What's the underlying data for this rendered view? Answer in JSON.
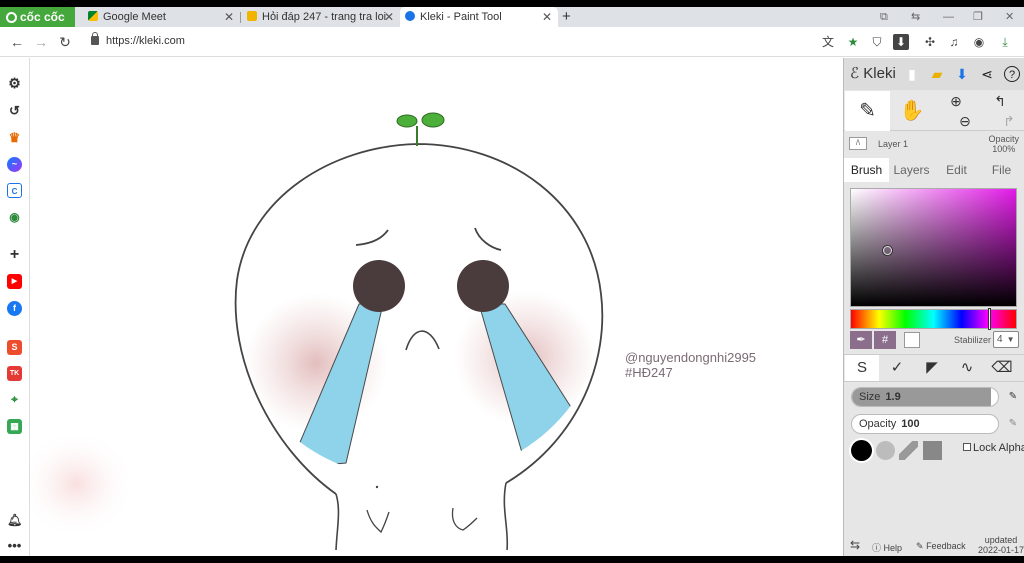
{
  "browser": {
    "brand": "cốc cốc",
    "tabs": [
      {
        "title": "Google Meet",
        "active": false
      },
      {
        "title": "Hỏi đáp 247 - trang tra loi",
        "active": false
      },
      {
        "title": "Kleki - Paint Tool",
        "active": true
      }
    ],
    "new_tab": "+",
    "url": "https://kleki.com"
  },
  "sidebar": {
    "items": [
      "settings-icon",
      "history-icon",
      "crown-icon",
      "messenger-icon",
      "coccoc-icon",
      "game-icon",
      "add-icon",
      "youtube-icon",
      "facebook-icon",
      "shopee-icon",
      "tiki-icon",
      "maps-icon",
      "sheet-icon",
      "bell-icon",
      "more-icon"
    ]
  },
  "canvas": {
    "signature_line1": "@nguyendongnhi2995",
    "signature_line2": "#HĐ247"
  },
  "kleki": {
    "logo": "Kleki",
    "layer": {
      "thumb": "/\\",
      "name": "Layer 1",
      "opacity_label": "Opacity",
      "opacity_value": "100%"
    },
    "tabs": [
      "Brush",
      "Layers",
      "Edit",
      "File"
    ],
    "active_tab": "Brush",
    "color": {
      "hex": "#ffffff",
      "hue_mark": "#f0f"
    },
    "picker_hash": "#",
    "stabilizer_label": "Stabilizer",
    "stabilizer_value": "4",
    "size_label": "Size",
    "size_value": "1.9",
    "size_fraction": 0.95,
    "opacity_label": "Opacity",
    "opacity_value": "100",
    "lock_alpha": "Lock Alpha",
    "footer": {
      "help": "Help",
      "feedback": "Feedback",
      "updated_label": "updated",
      "updated_date": "2022-01-17"
    }
  }
}
